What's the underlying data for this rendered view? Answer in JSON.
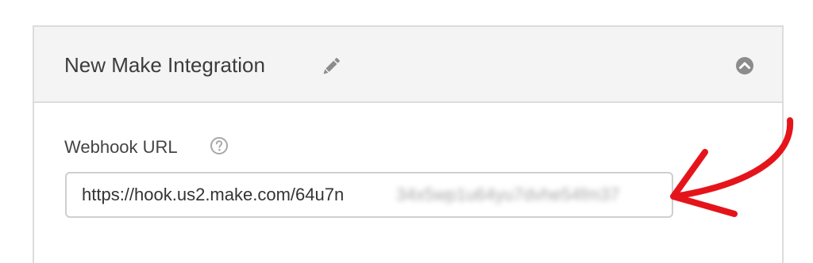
{
  "integration": {
    "title": "New Make Integration",
    "edit_icon": "pencil-icon",
    "collapse_icon": "chevron-up-circle-icon"
  },
  "webhook": {
    "label": "Webhook URL",
    "help_icon": "question-circle-icon",
    "url_visible": "https://hook.us2.make.com/64u7n",
    "url_obscured": "34x5wp1u64yu7dvhe54fm37"
  },
  "annotation": {
    "icon": "red-arrow-icon",
    "color": "#e5141b"
  },
  "colors": {
    "header_bg": "#f4f4f4",
    "border": "#dcdcdc",
    "icon_gray": "#8c8c8c"
  }
}
